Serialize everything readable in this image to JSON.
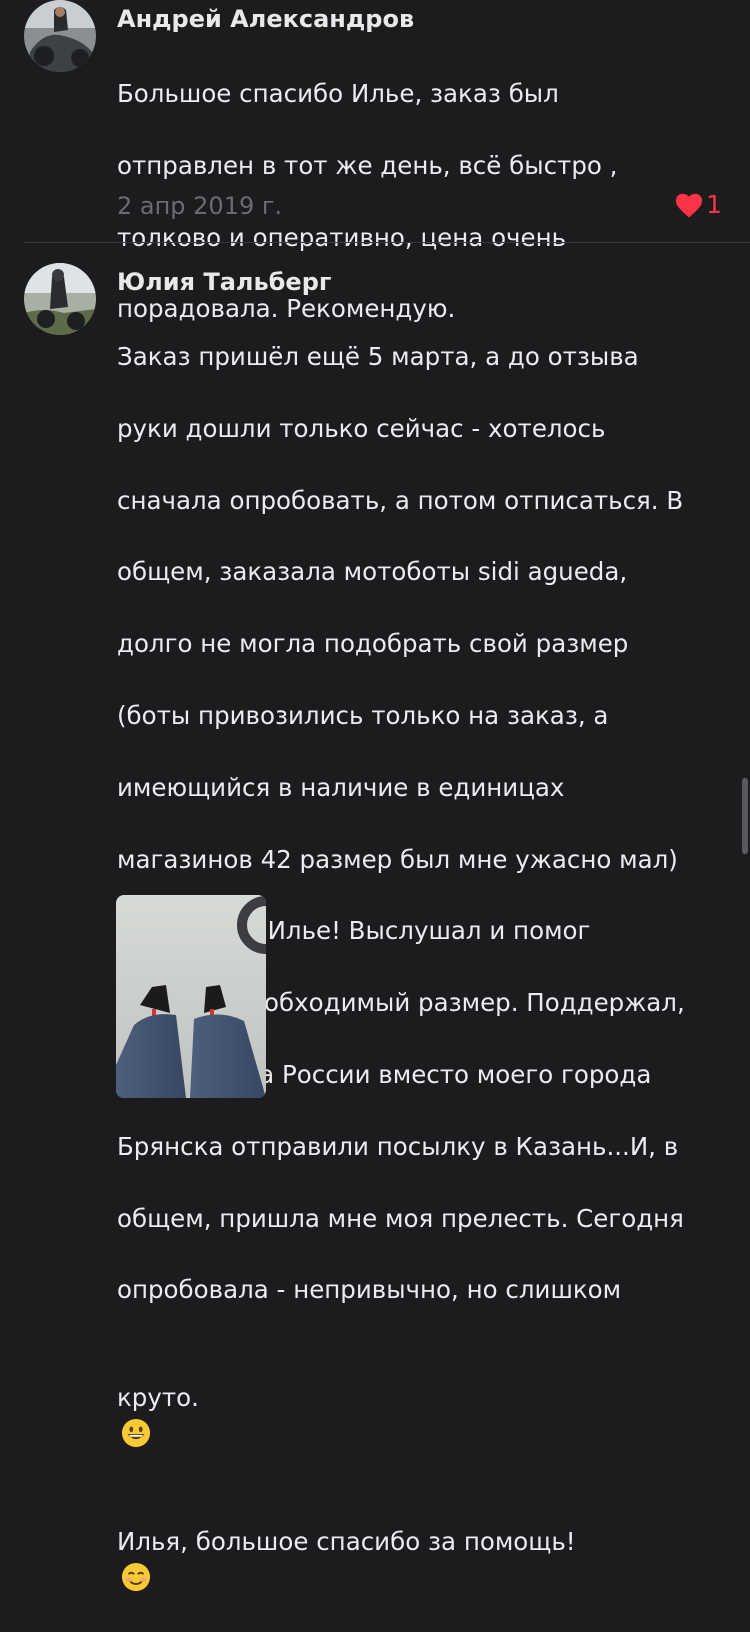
{
  "comments": [
    {
      "author": "Андрей Александров",
      "lines": [
        "Большое спасибо Илье, заказ был",
        "отправлен в тот же день, всё быстро ,",
        "толково и оперативно,  цена очень",
        "порадовала. Рекомендую."
      ],
      "date": "2 апр 2019 г.",
      "likes": "1",
      "avatar_icon": "motorcycle-rider-photo"
    },
    {
      "author": "Юлия Тальберг",
      "lines": [
        "Заказ пришёл ещё 5 марта, а до отзыва",
        "руки дошли только сейчас - хотелось",
        "сначала опробовать, а потом отписаться. В",
        "общем, заказала мотоботы sidi agueda,",
        "долго не могла подобрать свой размер",
        "(боты привозились только на заказ, а",
        "имеющийся в наличие в единицах",
        "магазинов 42 размер был мне ужасно мал)",
        "но спасибо Илье! Выслушал и помог",
        "выбрать необходимый размер. Поддержал,",
        "когда почта России вместо моего города",
        "Брянска отправили посылку в Казань...И, в",
        "общем, пришла мне моя прелесть. Сегодня",
        "опробовала - непривычно, но слишком",
        "круто.",
        "Илья, большое спасибо за помощь!"
      ],
      "emoji_1": "grinning-face-emoji",
      "emoji_2": "smiling-face-emoji",
      "avatar_icon": "person-on-motorcycle-photo",
      "attachment_icon": "boots-photo"
    }
  ],
  "colors": {
    "background": "#1c1c1e",
    "heart": "#ff3347",
    "text": "#ebebf0",
    "muted": "#6b6b70"
  }
}
